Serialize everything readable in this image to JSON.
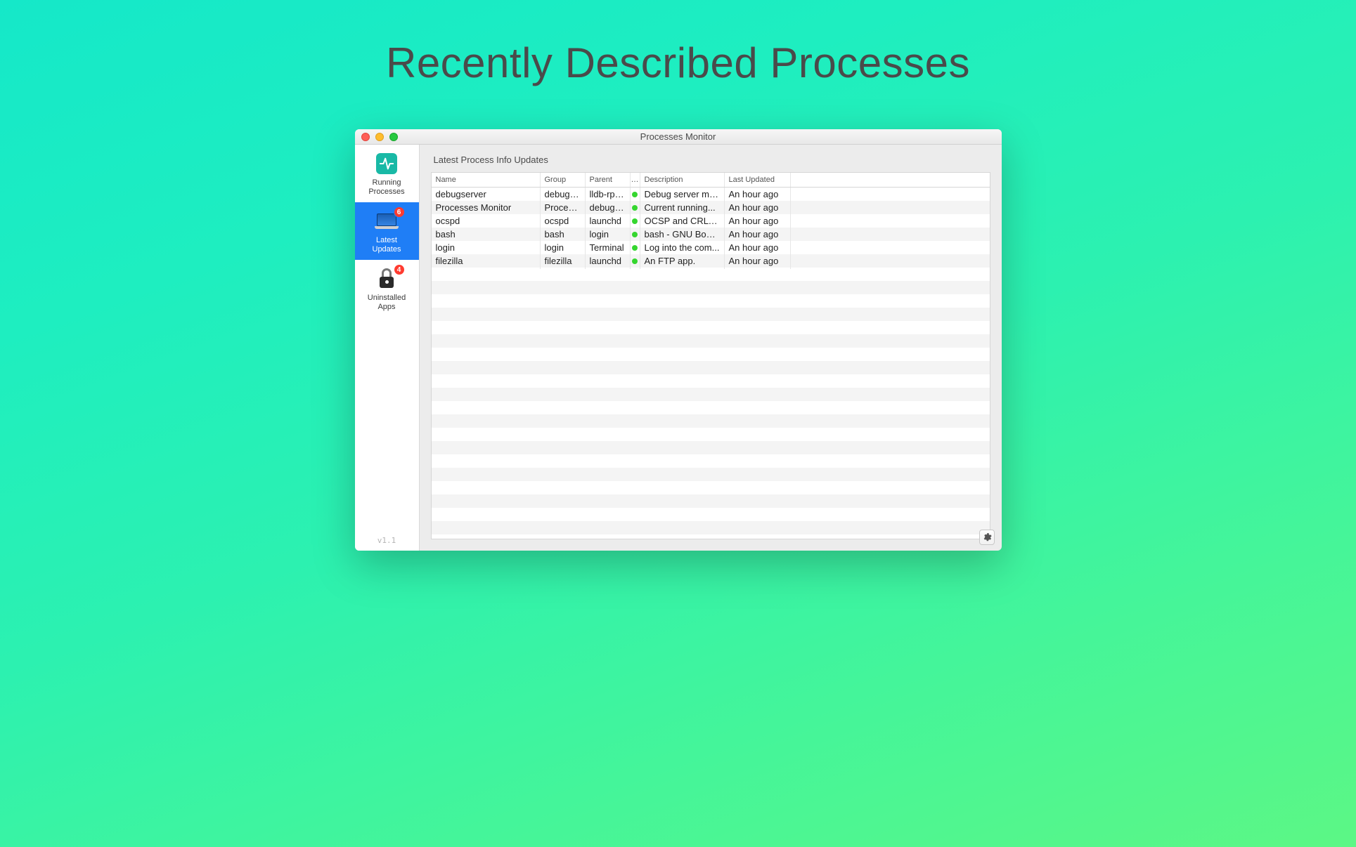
{
  "hero": {
    "title": "Recently Described Processes"
  },
  "window": {
    "title": "Processes Monitor"
  },
  "sidebar": {
    "items": [
      {
        "label": "Running\nProcesses",
        "badge": ""
      },
      {
        "label": "Latest\nUpdates",
        "badge": "6"
      },
      {
        "label": "Uninstalled\nApps",
        "badge": "4"
      }
    ],
    "version": "v1.1"
  },
  "main": {
    "section_title": "Latest Process Info Updates",
    "columns": {
      "name": "Name",
      "group": "Group",
      "parent": "Parent",
      "dot": "…",
      "description": "Description",
      "last_updated": "Last Updated"
    },
    "rows": [
      {
        "name": "debugserver",
        "group": "debugs...",
        "parent": "lldb-rpc...",
        "status": "green",
        "description": "Debug server ma...",
        "last_updated": "An hour ago"
      },
      {
        "name": "Processes Monitor",
        "group": "Process...",
        "parent": "debugs...",
        "status": "green",
        "description": "Current running...",
        "last_updated": "An hour ago"
      },
      {
        "name": "ocspd",
        "group": "ocspd",
        "parent": "launchd",
        "status": "green",
        "description": "OCSP and CRL D...",
        "last_updated": "An hour ago"
      },
      {
        "name": "bash",
        "group": "bash",
        "parent": "login",
        "status": "green",
        "description": "bash - GNU Bour...",
        "last_updated": "An hour ago"
      },
      {
        "name": "login",
        "group": "login",
        "parent": "Terminal",
        "status": "green",
        "description": "Log into the com...",
        "last_updated": "An hour ago"
      },
      {
        "name": "filezilla",
        "group": "filezilla",
        "parent": "launchd",
        "status": "green",
        "description": "An FTP app.",
        "last_updated": "An hour ago"
      }
    ]
  }
}
